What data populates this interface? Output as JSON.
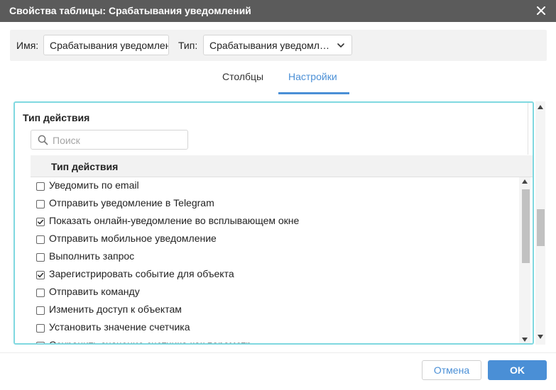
{
  "window": {
    "title": "Свойства таблицы: Срабатывания уведомлений",
    "close_icon": "close-icon"
  },
  "header": {
    "name_label": "Имя:",
    "name_value": "Срабатывания уведомлений",
    "type_label": "Тип:",
    "type_value": "Срабатывания уведомлений",
    "type_icon": "chevron-down-icon"
  },
  "tabs": [
    {
      "label": "Столбцы",
      "active": false
    },
    {
      "label": "Настройки",
      "active": true
    }
  ],
  "settings": {
    "section_title": "Тип действия",
    "search_placeholder": "Поиск",
    "search_icon": "search-icon",
    "table_header": "Тип действия",
    "rows": [
      {
        "label": "Уведомить по email",
        "checked": false
      },
      {
        "label": "Отправить уведомление в Telegram",
        "checked": false
      },
      {
        "label": "Показать онлайн-уведомление во всплывающем окне",
        "checked": true
      },
      {
        "label": "Отправить мобильное уведомление",
        "checked": false
      },
      {
        "label": "Выполнить запрос",
        "checked": false
      },
      {
        "label": "Зарегистрировать событие для объекта",
        "checked": true
      },
      {
        "label": "Отправить команду",
        "checked": false
      },
      {
        "label": "Изменить доступ к объектам",
        "checked": false
      },
      {
        "label": "Установить значение счетчика",
        "checked": false
      },
      {
        "label": "Сохранить значение счетчика как параметр",
        "checked": false
      }
    ]
  },
  "footer": {
    "cancel_label": "Отмена",
    "ok_label": "OK"
  },
  "colors": {
    "titlebar": "#5b5b5b",
    "accent": "#4a8fd6",
    "panel_border": "#7fd8e0"
  }
}
